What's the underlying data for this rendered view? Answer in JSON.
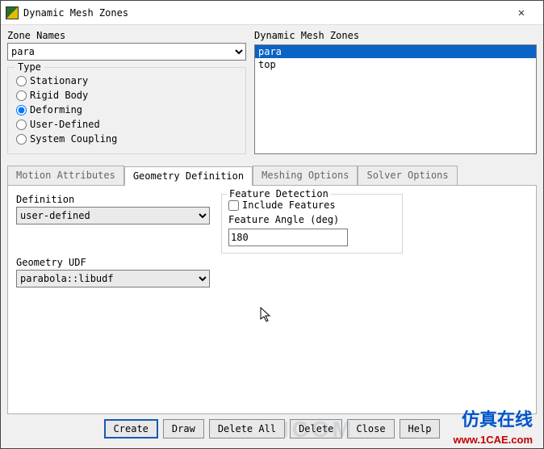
{
  "window": {
    "title": "Dynamic Mesh Zones"
  },
  "zone_names": {
    "label": "Zone Names",
    "selected": "para"
  },
  "type_group": {
    "legend": "Type",
    "options": {
      "stationary": "Stationary",
      "rigid_body": "Rigid Body",
      "deforming": "Deforming",
      "user_defined": "User-Defined",
      "system_coupling": "System Coupling"
    },
    "selected": "deforming"
  },
  "zone_list": {
    "label": "Dynamic Mesh Zones",
    "items": [
      "para",
      "top"
    ],
    "selected_index": 0
  },
  "tabs": {
    "motion": "Motion Attributes",
    "geometry": "Geometry Definition",
    "meshing": "Meshing Options",
    "solver": "Solver Options"
  },
  "geom_tab": {
    "definition_label": "Definition",
    "definition_value": "user-defined",
    "udf_label": "Geometry UDF",
    "udf_value": "parabola::libudf",
    "feature_legend": "Feature Detection",
    "include_features_label": "Include Features",
    "include_features_checked": false,
    "feature_angle_label": "Feature Angle (deg)",
    "feature_angle_value": "180"
  },
  "buttons": {
    "create": "Create",
    "draw": "Draw",
    "delete_all": "Delete All",
    "delete": "Delete",
    "close": "Close",
    "help": "Help"
  },
  "watermark": {
    "brand": "仿真在线",
    "url": "www.1CAE.com",
    "icom": "ICOM"
  }
}
